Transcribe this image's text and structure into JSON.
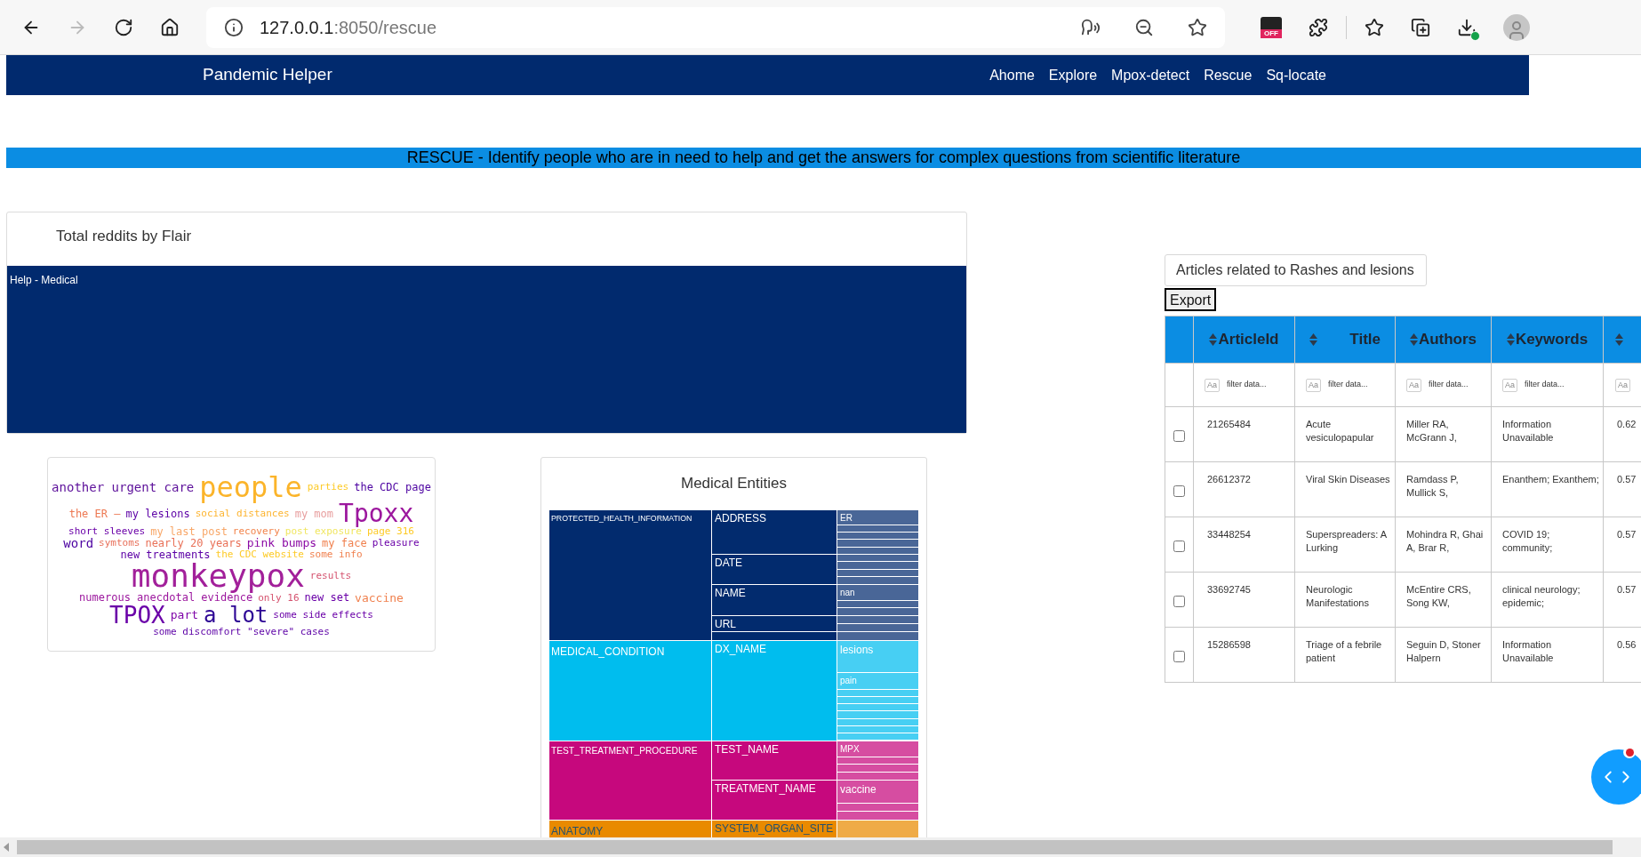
{
  "browser": {
    "url_host": "127.0.0.1",
    "url_path": ":8050/rescue",
    "back_disabled": false,
    "forward_disabled": true,
    "extension_badge": "OFF"
  },
  "navbar": {
    "brand": "Pandemic Helper",
    "links": [
      "Ahome",
      "Explore",
      "Mpox-detect",
      "Rescue",
      "Sq-locate"
    ]
  },
  "banner": "RESCUE - Identify people who are in need to help and get the answers for complex questions from scientific literature",
  "flair_chart": {
    "title": "Total reddits by Flair",
    "segment": "Help - Medical"
  },
  "word_cloud": [
    {
      "text": "another urgent care",
      "color": "#5c0f9a"
    },
    {
      "text": "people",
      "color": "#fbb42a"
    },
    {
      "text": "parties",
      "color": "#fdca26"
    },
    {
      "text": "the CDC page",
      "color": "#4c02a1"
    },
    {
      "text": "the ER —",
      "color": "#ed7953"
    },
    {
      "text": "my lesions",
      "color": "#5c01a6"
    },
    {
      "text": "social distances",
      "color": "#fdb42f"
    },
    {
      "text": "my mom",
      "color": "#e8a0a0"
    },
    {
      "text": "Tpoxx",
      "color": "#9c179e"
    },
    {
      "text": "short sleeves",
      "color": "#6a00a8"
    },
    {
      "text": "my last post",
      "color": "#f8a86a"
    },
    {
      "text": "recovery",
      "color": "#f2844b"
    },
    {
      "text": "post exposure",
      "color": "#f0e660"
    },
    {
      "text": "page 316",
      "color": "#fdca26"
    },
    {
      "text": "word",
      "color": "#4c02a1"
    },
    {
      "text": "symtoms",
      "color": "#e8705a"
    },
    {
      "text": "nearly 20 years",
      "color": "#e97158"
    },
    {
      "text": "pink bumps",
      "color": "#8b0aa5"
    },
    {
      "text": "my face",
      "color": "#f0804e"
    },
    {
      "text": "pleasure",
      "color": "#6a00a8"
    },
    {
      "text": "new treatments",
      "color": "#5c01a6"
    },
    {
      "text": "the CDC website",
      "color": "#fdca26"
    },
    {
      "text": "some info",
      "color": "#f0804e"
    },
    {
      "text": "monkeypox",
      "color": "#a2209a"
    },
    {
      "text": "results",
      "color": "#d5536f"
    },
    {
      "text": "numerous anecdotal evidence",
      "color": "#9c179e"
    },
    {
      "text": "only 16",
      "color": "#d5536f"
    },
    {
      "text": "new set",
      "color": "#6a00a8"
    },
    {
      "text": "vaccine",
      "color": "#f0804e"
    },
    {
      "text": "TPOX",
      "color": "#6a00a8"
    },
    {
      "text": "part",
      "color": "#7e03a8"
    },
    {
      "text": "a lot",
      "color": "#2c0594"
    },
    {
      "text": "some side effects",
      "color": "#6a00a8"
    },
    {
      "text": "some discomfort \"severe\" cases",
      "color": "#5c01a6"
    }
  ],
  "medical_entities": {
    "title": "Medical Entities",
    "groups": [
      {
        "label": "PROTECTED_HEALTH_INFORMATION",
        "color": "#022b6e",
        "children": [
          {
            "label": "ADDRESS",
            "children": [
              {
                "label": "ER"
              }
            ]
          },
          {
            "label": "DATE"
          },
          {
            "label": "NAME",
            "children": [
              {
                "label": "nan"
              }
            ]
          },
          {
            "label": "URL"
          }
        ]
      },
      {
        "label": "MEDICAL_CONDITION",
        "color": "#00bdee",
        "children": [
          {
            "label": "DX_NAME",
            "children": [
              {
                "label": "lesions"
              },
              {
                "label": "pain"
              }
            ]
          }
        ]
      },
      {
        "label": "TEST_TREATMENT_PROCEDURE",
        "color": "#c6087d",
        "children": [
          {
            "label": "TEST_NAME",
            "children": [
              {
                "label": "MPX"
              }
            ]
          },
          {
            "label": "TREATMENT_NAME",
            "children": [
              {
                "label": "vaccine"
              }
            ]
          }
        ]
      },
      {
        "label": "ANATOMY",
        "color": "#e98a00",
        "children": [
          {
            "label": "SYSTEM_ORGAN_SITE"
          }
        ]
      }
    ]
  },
  "articles": {
    "search_value": "Articles related to Rashes and lesions",
    "export_label": "Export",
    "columns": [
      "ArticleId",
      "Title",
      "Authors",
      "Keywords"
    ],
    "filters": [
      {
        "toggle": "Aa",
        "placeholder": "filter data..."
      },
      {
        "toggle": "Aa",
        "placeholder": "filter data..."
      },
      {
        "toggle": "Aa",
        "placeholder": "filter data..."
      },
      {
        "toggle": "Aa",
        "placeholder": "filter data..."
      },
      {
        "toggle": "Aa"
      }
    ],
    "rows": [
      {
        "checked": false,
        "cells": [
          "21265484",
          "Acute vesiculopapular",
          "Miller RA, McGrann J,",
          "Information Unavailable",
          "0.62"
        ]
      },
      {
        "checked": false,
        "cells": [
          "26612372",
          "Viral Skin Diseases",
          "Ramdass P, Mullick S,",
          "Enanthem; Exanthem;",
          "0.57"
        ]
      },
      {
        "checked": false,
        "cells": [
          "33448254",
          "Superspreaders: A Lurking",
          "Mohindra R, Ghai A, Brar R,",
          "COVID 19; community;",
          "0.57"
        ]
      },
      {
        "checked": false,
        "cells": [
          "33692745",
          "Neurologic Manifestations",
          "McEntire CRS, Song KW,",
          "clinical neurology; epidemic;",
          "0.57"
        ]
      },
      {
        "checked": false,
        "cells": [
          "15286598",
          "Triage of a febrile patient",
          "Seguin D, Stoner Halpern",
          "Information Unavailable",
          "0.56"
        ]
      }
    ]
  }
}
